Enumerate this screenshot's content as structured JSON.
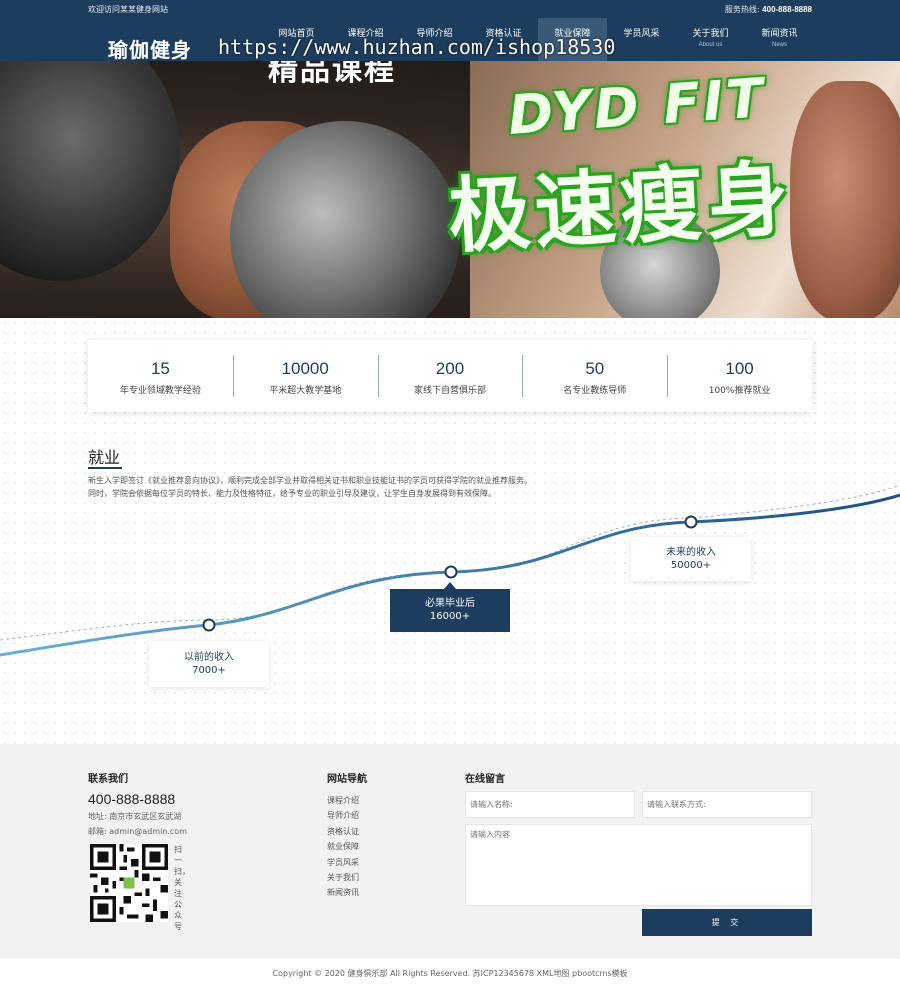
{
  "topbar": {
    "welcome": "欢迎访问某某健身网站",
    "hotline_label": "服务热线:",
    "hotline_number": "400-888-8888"
  },
  "logo": "瑜伽健身",
  "watermark": "https://www.huzhan.com/ishop18530",
  "nav": [
    {
      "zh": "网站首页",
      "en": ""
    },
    {
      "zh": "课程介绍",
      "en": ""
    },
    {
      "zh": "导师介绍",
      "en": ""
    },
    {
      "zh": "资格认证",
      "en": ""
    },
    {
      "zh": "就业保障",
      "en": ""
    },
    {
      "zh": "学员风采",
      "en": ""
    },
    {
      "zh": "关于我们",
      "en": "About us"
    },
    {
      "zh": "新闻资讯",
      "en": "News"
    }
  ],
  "nav_active_index": 4,
  "banner": {
    "caption_top": "精品课程",
    "slogan_en": "DYD FIT",
    "slogan_zh": "极速瘦身"
  },
  "stats": [
    {
      "num": "15",
      "label": "年专业领域教学经验"
    },
    {
      "num": "10000",
      "label": "平米超大教学基地"
    },
    {
      "num": "200",
      "label": "家线下自营俱乐部"
    },
    {
      "num": "50",
      "label": "名专业教练导师"
    },
    {
      "num": "100",
      "label": "100%推荐就业"
    }
  ],
  "employment": {
    "title": "就业",
    "desc_line1": "新生入学即签订《就业推荐意向协议》，顺利完成全部学业并取得相关证书和职业技能证书的学员可获得学院的就业推荐服务。",
    "desc_line2": "同时，学院会依据每位学员的特长、能力及性格特征，给予专业的职业引导及建议，让学生自身发展得到有效保障。",
    "points": [
      {
        "label": "以前的收入",
        "value": "7000+"
      },
      {
        "label": "必果毕业后",
        "value": "16000+"
      },
      {
        "label": "未来的收入",
        "value": "50000+"
      }
    ]
  },
  "footer": {
    "contact_title": "联系我们",
    "phone": "400-888-8888",
    "address": "地址:   南京市玄武区玄武湖",
    "email": "邮箱:   admin@admin.com",
    "qr_caption": "扫一扫，关注公众号",
    "nav_title": "网站导航",
    "nav_links": [
      "课程介绍",
      "导师介绍",
      "资格认证",
      "就业保障",
      "学员风采",
      "关于我们",
      "新闻资讯"
    ],
    "message_title": "在线留言",
    "name_placeholder": "请输入名称:",
    "contact_placeholder": "请输入联系方式:",
    "content_placeholder": "请输入内容",
    "submit_label": "提 交"
  },
  "copyright": "Copyright © 2020 健身俱乐部 All Rights Reserved. 苏ICP12345678 XML地图 pbootcms模板",
  "colors": {
    "primary": "#1d3d5f",
    "accent_line": "#3a78a8",
    "slogan_green": "#2aa31e"
  }
}
